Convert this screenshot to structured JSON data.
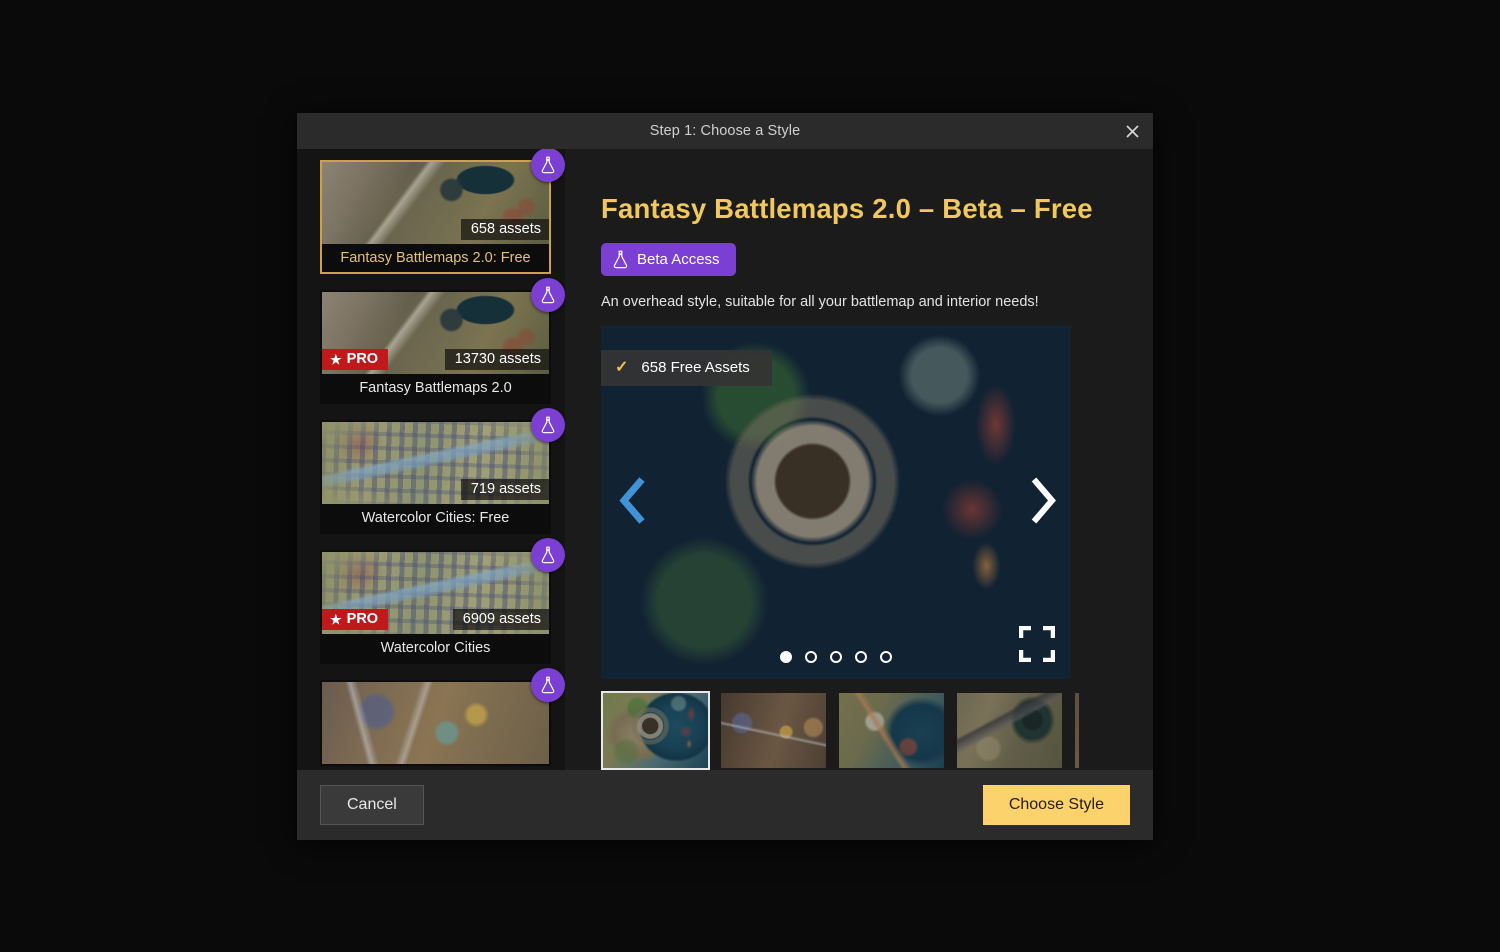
{
  "window": {
    "title": "Step 1: Choose a Style",
    "close_label": "×"
  },
  "sidebar": {
    "styles": [
      {
        "name": "Fantasy Battlemaps 2.0: Free",
        "asset_count": "658 assets",
        "pro": false,
        "pro_label": "",
        "beta": true,
        "selected": true,
        "art": "art-ruins"
      },
      {
        "name": "Fantasy Battlemaps 2.0",
        "asset_count": "13730 assets",
        "pro": true,
        "pro_label": "PRO",
        "beta": true,
        "selected": false,
        "art": "art-ruins"
      },
      {
        "name": "Watercolor Cities: Free",
        "asset_count": "719 assets",
        "pro": false,
        "pro_label": "",
        "beta": true,
        "selected": false,
        "art": "art-city"
      },
      {
        "name": "Watercolor Cities",
        "asset_count": "6909 assets",
        "pro": true,
        "pro_label": "PRO",
        "beta": true,
        "selected": false,
        "art": "art-city"
      },
      {
        "name": "",
        "asset_count": "",
        "pro": false,
        "pro_label": "",
        "beta": true,
        "selected": false,
        "art": "art-town"
      }
    ]
  },
  "detail": {
    "title": "Fantasy Battlemaps 2.0 – Beta – Free",
    "beta_badge": "Beta Access",
    "description": "An overhead style, suitable for all your battlemap and interior needs!",
    "free_assets_badge": "658 Free Assets",
    "carousel": {
      "slide_count": 5,
      "active_index": 0,
      "prev_label": "‹",
      "next_label": "›",
      "expand_label": "fullscreen"
    },
    "thumbnails": [
      {
        "art": "art-harbor",
        "selected": true
      },
      {
        "art": "art-interior",
        "selected": false
      },
      {
        "art": "art-docks",
        "selected": false
      },
      {
        "art": "art-ruin2",
        "selected": false
      },
      {
        "art": "art-cave",
        "selected": false
      }
    ]
  },
  "footer": {
    "cancel_label": "Cancel",
    "confirm_label": "Choose Style"
  },
  "colors": {
    "accent_gold": "#f1c85c",
    "beta_purple": "#7b3fd4",
    "pro_red": "#c0191c",
    "confirm_yellow": "#fbd26b",
    "arrow_blue": "#3f93d6"
  }
}
